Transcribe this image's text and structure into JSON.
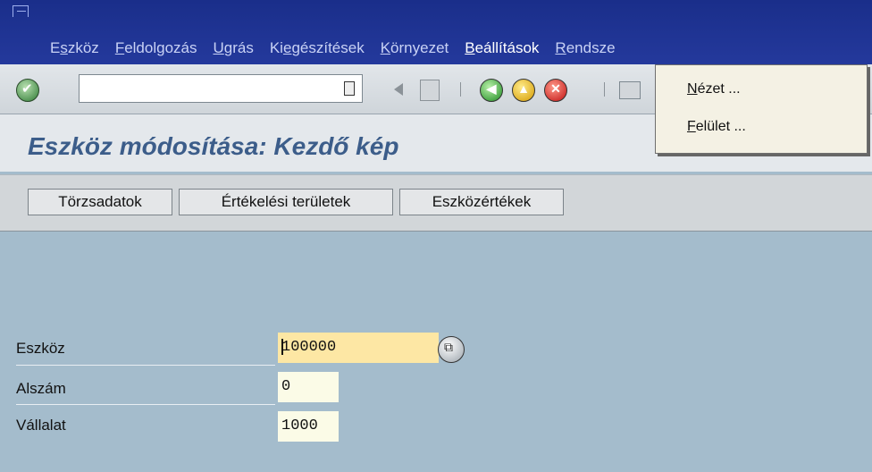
{
  "menubar": {
    "items": [
      {
        "pre": "E",
        "u": "s",
        "post": "zköz"
      },
      {
        "pre": "",
        "u": "F",
        "post": "eldolgozás"
      },
      {
        "pre": "",
        "u": "U",
        "post": "grás"
      },
      {
        "pre": "Ki",
        "u": "e",
        "post": "gészítések"
      },
      {
        "pre": "",
        "u": "K",
        "post": "örnyezet"
      },
      {
        "pre": "",
        "u": "B",
        "post": "eállítások"
      },
      {
        "pre": "",
        "u": "R",
        "post": "endsze"
      }
    ]
  },
  "dropdown": {
    "items": [
      {
        "u": "N",
        "post": "ézet ..."
      },
      {
        "u": "F",
        "post": "elület ..."
      }
    ]
  },
  "title": "Eszköz módosítása: Kezdő kép",
  "appbar": {
    "buttons": [
      "Törzsadatok",
      "Értékelési területek",
      "Eszközértékek"
    ]
  },
  "form": {
    "rows": [
      {
        "label": "Eszköz",
        "value": "100000"
      },
      {
        "label": "Alszám",
        "value": "0"
      },
      {
        "label": "Vállalat",
        "value": "1000"
      }
    ]
  },
  "colors": {
    "menubar": "#24399c",
    "background": "#a4bccc",
    "focus_field": "#fde7a4"
  }
}
